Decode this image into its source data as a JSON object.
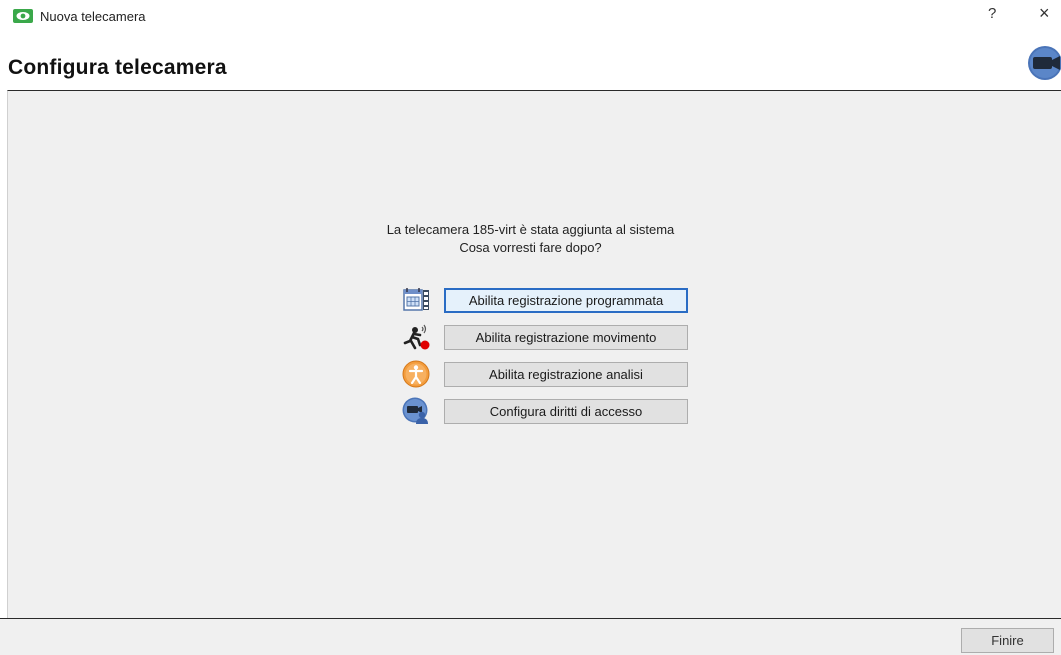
{
  "window": {
    "title": "Nuova telecamera",
    "help_label": "?",
    "close_label": "×",
    "icon": "eye-icon"
  },
  "header": {
    "title": "Configura telecamera",
    "icon": "camera-icon"
  },
  "message": {
    "line1": "La telecamera 185-virt è stata aggiunta al sistema",
    "line2": "Cosa vorresti fare dopo?"
  },
  "options": [
    {
      "label": "Abilita registrazione programmata",
      "icon": "schedule-calendar-icon",
      "focused": true
    },
    {
      "label": "Abilita registrazione movimento",
      "icon": "motion-runner-icon",
      "focused": false
    },
    {
      "label": "Abilita registrazione analisi",
      "icon": "analytics-person-icon",
      "focused": false
    },
    {
      "label": "Configura diritti di accesso",
      "icon": "access-rights-icon",
      "focused": false
    }
  ],
  "footer": {
    "finish_label": "Finire"
  },
  "colors": {
    "app_icon_green": "#3aa84a",
    "focus_border": "#2a6cc4",
    "content_bg": "#f0f0f0",
    "button_bg": "#e1e1e1"
  }
}
